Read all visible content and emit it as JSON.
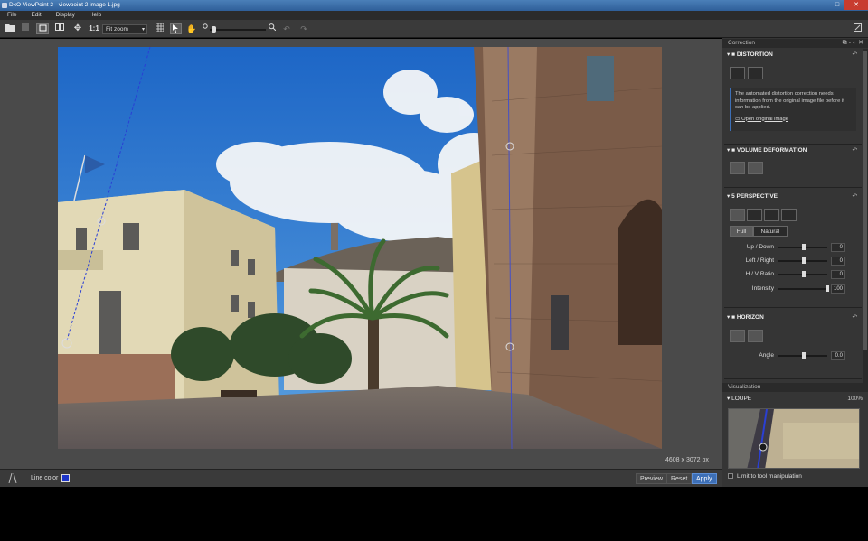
{
  "window": {
    "title": "DxO ViewPoint 2 - viewpoint 2 image 1.jpg",
    "minimize": "—",
    "maximize": "□",
    "close": "✕"
  },
  "menu": [
    "File",
    "Edit",
    "Display",
    "Help"
  ],
  "toolbar": {
    "one_to_one": "1:1",
    "zoom_value": "Fit zoom"
  },
  "canvas": {
    "image_size": "4608 x 3072 px"
  },
  "bottom": {
    "line_color_label": "Line color",
    "line_color": "#1d35c9",
    "preview": "Preview",
    "reset": "Reset",
    "apply": "Apply"
  },
  "panel": {
    "correction_title": "Correction",
    "distortion": {
      "title": "DISTORTION",
      "info": "The automated distortion correction needs information from the original image file before it can be applied.",
      "link": "Open original image"
    },
    "volume": {
      "title": "VOLUME DEFORMATION"
    },
    "perspective": {
      "title": "PERSPECTIVE",
      "modes": [
        "Full",
        "Natural"
      ],
      "params": [
        {
          "label": "Up / Down",
          "value": "0",
          "level": 0.5
        },
        {
          "label": "Left / Right",
          "value": "0",
          "level": 0.5
        },
        {
          "label": "H / V Ratio",
          "value": "0",
          "level": 0.5
        },
        {
          "label": "Intensity",
          "value": "100",
          "level": 1.0
        }
      ]
    },
    "horizon": {
      "title": "HORIZON",
      "angle_label": "Angle",
      "angle_value": "0.0"
    },
    "visualization_title": "Visualization",
    "loupe": {
      "title": "LOUPE",
      "zoom": "100%"
    },
    "limit_label": "Limit to tool manipulation"
  },
  "accent": "#3d6fb6"
}
